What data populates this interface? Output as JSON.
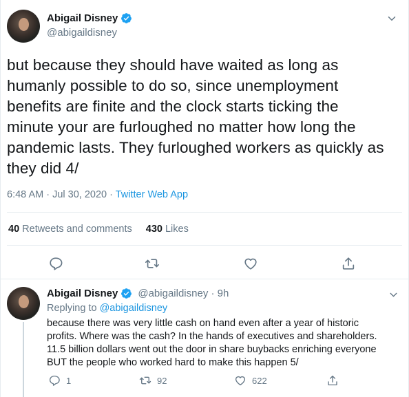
{
  "main_tweet": {
    "author_name": "Abigail Disney",
    "author_handle": "@abigaildisney",
    "text": "but because they should have waited as long as\nhumanly possible to do so, since unemployment\nbenefits are finite and the clock starts ticking the\nminute your are furloughed no matter how long the\npandemic lasts.  They furloughed workers as quickly as\nthey did 4/",
    "timestamp": "6:48 AM · Jul 30, 2020 · ",
    "source": "Twitter Web App",
    "retweets_count": "40",
    "retweets_label": "Retweets and comments",
    "likes_count": "430",
    "likes_label": "Likes"
  },
  "reply_tweet": {
    "author_name": "Abigail Disney",
    "author_handle": "@abigaildisney · 9h",
    "replying_prefix": "Replying to ",
    "replying_to": "@abigaildisney",
    "text": "because there was very little cash on hand even after a year of historic\nprofits.  Where was the cash?  In the hands of executives and shareholders.\n11.5 billion dollars went out the door in share buybacks enriching everyone\nBUT the people who worked hard to make this happen 5/",
    "reply_count": "1",
    "retweet_count": "92",
    "like_count": "622"
  },
  "colors": {
    "accent": "#1b95e0",
    "verified": "#1da1f2",
    "muted": "#657786",
    "text": "#14171a",
    "divider": "#e6ecf0"
  },
  "icons": [
    "verified-badge-icon",
    "chevron-down-icon",
    "reply-icon",
    "retweet-icon",
    "like-icon",
    "share-icon"
  ]
}
